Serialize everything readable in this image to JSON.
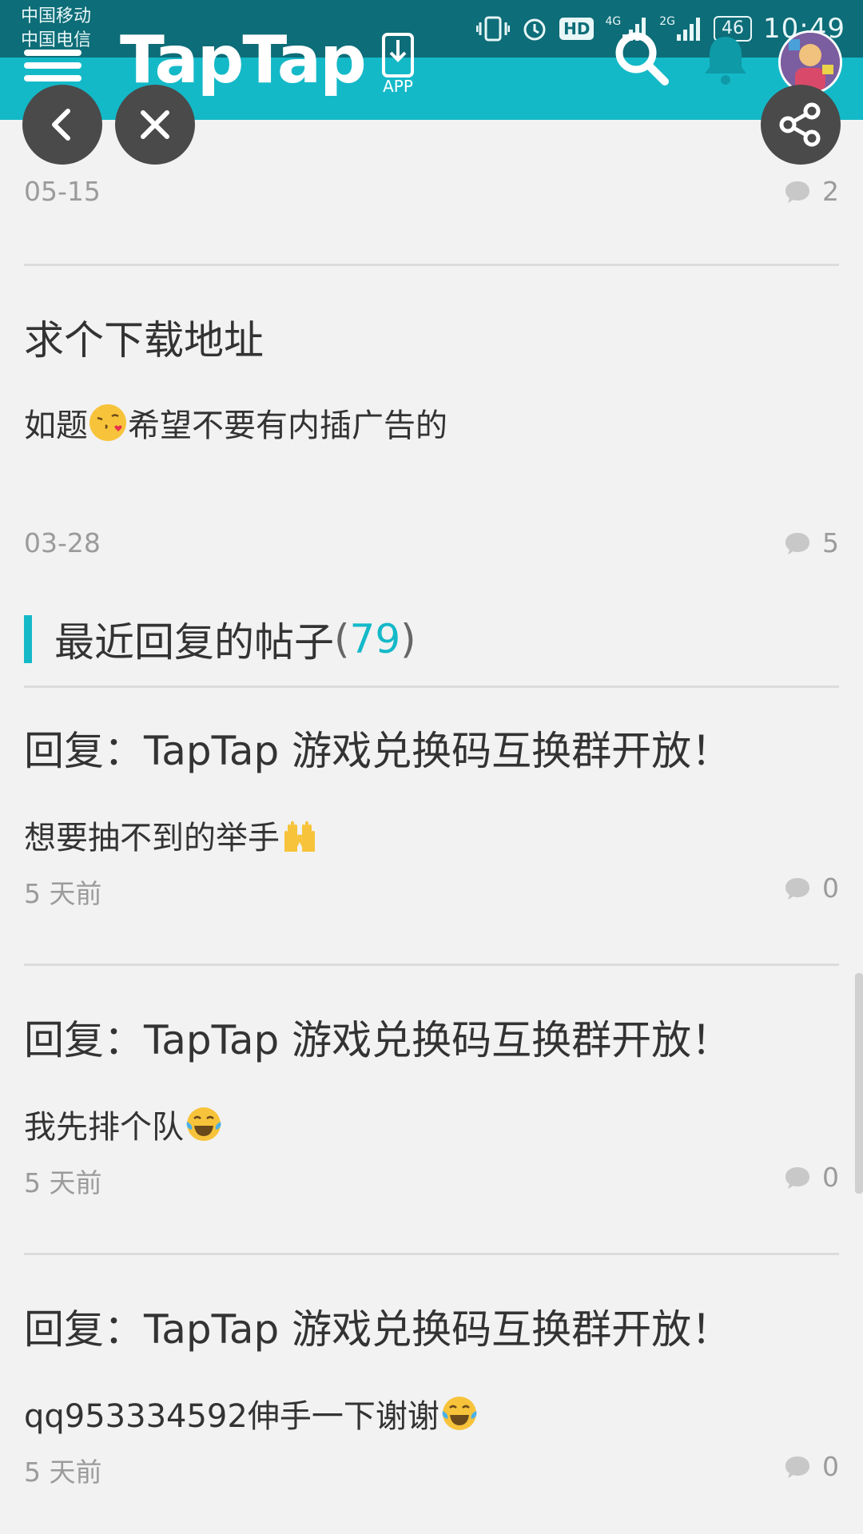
{
  "status_bar": {
    "carrier1": "中国移动",
    "carrier2": "中国电信",
    "network1": "4G",
    "network2": "2G",
    "hd": "HD",
    "battery": "46",
    "time": "10:49"
  },
  "header": {
    "logo": "TapTap",
    "app_label": "APP",
    "accent": "#14b9c8"
  },
  "posts_top": [
    {
      "date": "05-15",
      "comments": "2"
    },
    {
      "title": "求个下载地址",
      "body_before": "如题",
      "body_after": "希望不要有内插广告的",
      "emoji": "kissing-heart-emoji",
      "date": "03-28",
      "comments": "5"
    }
  ],
  "section": {
    "title": "最近回复的帖子",
    "open_paren": "(",
    "count": "79",
    "close_paren": ")"
  },
  "replies": [
    {
      "title": "回复：TapTap 游戏兑换码互换群开放！",
      "body": "想要抽不到的举手",
      "emoji": "raising-hands-emoji",
      "date": "5 天前",
      "comments": "0"
    },
    {
      "title": "回复：TapTap 游戏兑换码互换群开放！",
      "body": "我先排个队",
      "emoji": "tears-of-joy-emoji",
      "date": "5 天前",
      "comments": "0"
    },
    {
      "title": "回复：TapTap 游戏兑换码互换群开放！",
      "body": "qq953334592伸手一下谢谢",
      "emoji": "tears-of-joy-emoji",
      "date": "5 天前",
      "comments": "0"
    }
  ]
}
